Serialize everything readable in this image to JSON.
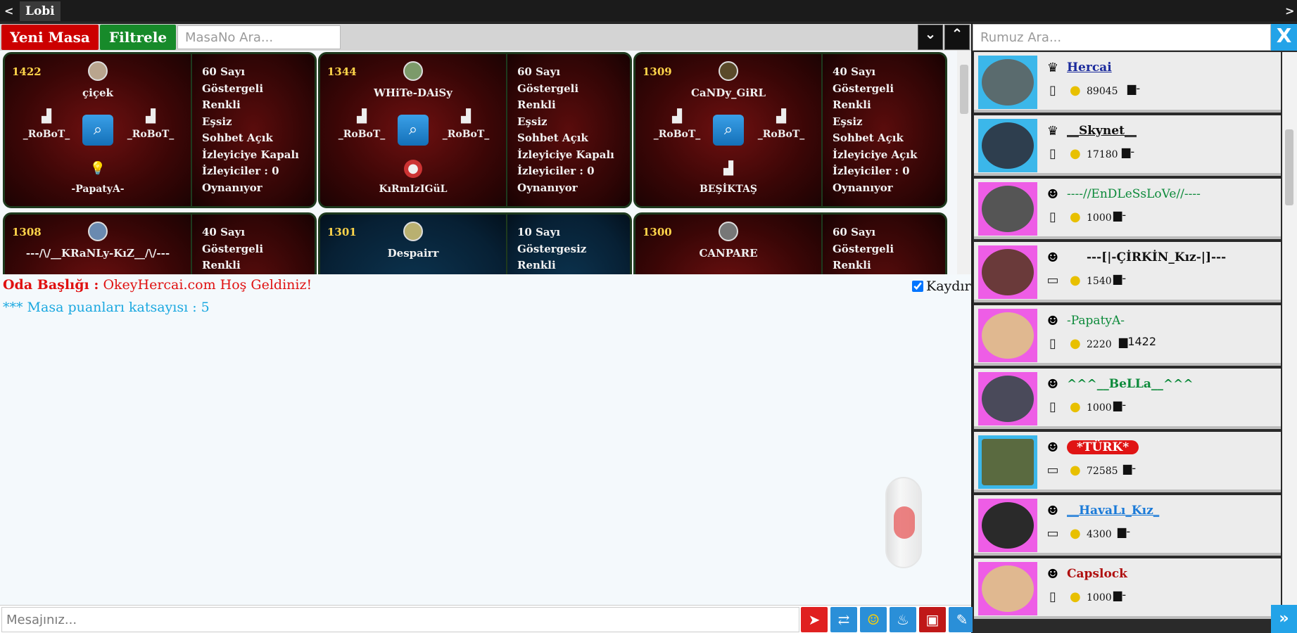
{
  "topbar": {
    "back": "<",
    "title": "Lobi",
    "forward": ">"
  },
  "toolbar": {
    "new_table": "Yeni Masa",
    "filter": "Filtrele",
    "table_search_placeholder": "MasaNo Ara...",
    "collapse_icon": "chevrons-down-icon",
    "expand_icon": "chevrons-up-icon"
  },
  "tables": [
    {
      "no": "1422",
      "owner": "çiçek",
      "seat_left": "_RoBoT_",
      "seat_right": "_RoBoT_",
      "seat_bottom": "-PapatyA-",
      "info": [
        "60 Sayı",
        "Göstergeli",
        "Renkli",
        "Eşsiz",
        "Sohbet Açık",
        "İzleyiciye Kapalı",
        "İzleyiciler : 0",
        "Oynanıyor"
      ],
      "theme": "red"
    },
    {
      "no": "1344",
      "owner": "WHiTe-DAiSy",
      "seat_left": "_RoBoT_",
      "seat_right": "_RoBoT_",
      "seat_bottom": "KıRmIzIGüL",
      "info": [
        "60 Sayı",
        "Göstergeli",
        "Renkli",
        "Eşsiz",
        "Sohbet Açık",
        "İzleyiciye Kapalı",
        "İzleyiciler : 0",
        "Oynanıyor"
      ],
      "theme": "red"
    },
    {
      "no": "1309",
      "owner": "CaNDy_GiRL",
      "seat_left": "_RoBoT_",
      "seat_right": "_RoBoT_",
      "seat_bottom": "BEŞİKTAŞ",
      "info": [
        "40 Sayı",
        "Göstergeli",
        "Renkli",
        "Eşsiz",
        "Sohbet Açık",
        "İzleyiciye Açık",
        "İzleyiciler : 0",
        "Oynanıyor"
      ],
      "theme": "red"
    },
    {
      "no": "1308",
      "owner": "---/\\/__KRaNLy-KıZ__/\\/---",
      "info": [
        "40 Sayı",
        "Göstergeli",
        "Renkli"
      ],
      "theme": "red"
    },
    {
      "no": "1301",
      "owner": "Despairr",
      "info": [
        "10 Sayı",
        "Göstergesiz",
        "Renkli"
      ],
      "theme": "blue"
    },
    {
      "no": "1300",
      "owner": "CANPARE",
      "info": [
        "60 Sayı",
        "Göstergeli",
        "Renkli"
      ],
      "theme": "red"
    }
  ],
  "chat": {
    "room_label": "Oda Başlığı :",
    "room_text": " OkeyHercai.com  Hoş Geldiniz!",
    "system_msg": "*** Masa puanları katsayısı : 5",
    "save_label": "Kaydır",
    "message_placeholder": "Mesajınız..."
  },
  "msg_icons": [
    "send-icon",
    "swap-icon",
    "emoji-icon",
    "tea-icon",
    "gift-icon",
    "brush-icon"
  ],
  "users": {
    "search_placeholder": "Rumuz Ara...",
    "close": "X",
    "more": "»",
    "list": [
      {
        "nick": "Hercai",
        "score": "89045",
        "table": "-",
        "frame": "blue",
        "color": "#1a2a9c",
        "device": "phone"
      },
      {
        "nick": "__Skynet__",
        "score": "17180",
        "table": "-",
        "frame": "blue",
        "color": "#111111",
        "device": "phone"
      },
      {
        "nick": "----//EnDLeSsLoVe//----",
        "score": "1000",
        "table": "-",
        "frame": "pink",
        "color": "#0c8a3a",
        "device": "phone"
      },
      {
        "nick": "---[|-ÇİRKİN_Kız-|]---",
        "score": "1540",
        "table": "-",
        "frame": "pink",
        "color": "#111111",
        "device": "pc"
      },
      {
        "nick": "-PapatyA-",
        "score": "2220",
        "table": "1422",
        "frame": "pink",
        "color": "#0c8a3a",
        "device": "phone"
      },
      {
        "nick": "^^^__BeLLa__^^^",
        "score": "1000",
        "table": "-",
        "frame": "pink",
        "color": "#0c8a3a",
        "device": "phone"
      },
      {
        "nick": "*TÜRK*",
        "score": "72585",
        "table": "-",
        "frame": "blue",
        "color": "#ffffff",
        "device": "pc"
      },
      {
        "nick": "__HavaLı_Kız_",
        "score": "4300",
        "table": "-",
        "frame": "pink",
        "color": "#1a7ad8",
        "device": "pc"
      },
      {
        "nick": "Capslock",
        "score": "1000",
        "table": "-",
        "frame": "pink",
        "color": "#b01010",
        "device": "phone"
      }
    ]
  }
}
